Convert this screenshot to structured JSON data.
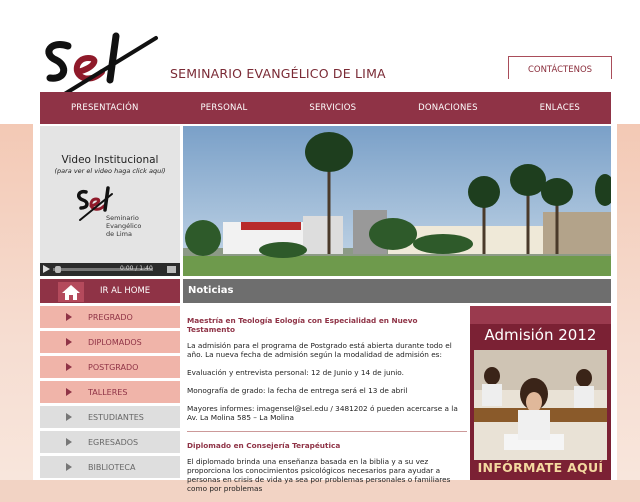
{
  "site": {
    "title": "SEMINARIO EVANGÉLICO DE LIMA",
    "logo_text": "sel"
  },
  "contact_label": "CONTÁCTENOS",
  "nav": [
    "PRESENTACIÓN",
    "PERSONAL",
    "SERVICIOS",
    "DONACIONES",
    "ENLACES"
  ],
  "video": {
    "title": "Video Institucional",
    "subtitle": "(para ver el video haga click aquí)",
    "logo_lines": [
      "Seminario",
      "Evangélico",
      "de Lima"
    ],
    "time": "0:00 / 1:40"
  },
  "home_label": "IR AL HOME",
  "menu": [
    {
      "label": "PREGRADO",
      "style": "pink"
    },
    {
      "label": "DIPLOMADOS",
      "style": "pink"
    },
    {
      "label": "POSTGRADO",
      "style": "pink"
    },
    {
      "label": "TALLERES",
      "style": "pink"
    },
    {
      "label": "ESTUDIANTES",
      "style": "grey"
    },
    {
      "label": "EGRESADOS",
      "style": "grey"
    },
    {
      "label": "BIBLIOTECA",
      "style": "grey"
    }
  ],
  "news": {
    "header": "Noticias",
    "item1": {
      "title": "Maestría en Teología Eología con Especialidad en Nuevo Testamento",
      "p1": "La admisión para el programa de Postgrado está abierta durante todo el año. La nueva fecha de admisión según la modalidad de admisión es:",
      "p2": "Evaluación y entrevista personal: 12 de Junio y 14 de junio.",
      "p3": "Monografía de grado: la fecha de entrega será el 13 de abril",
      "p4": "Mayores informes: imagensel@sel.edu / 3481202 ó pueden acercarse a la Av. La Molina 585 – La Molina"
    },
    "item2": {
      "title": "Diplomado en Consejería Terapéutica",
      "p1": "El diplomado brinda una enseñanza basada en la biblia y a su vez proporciona los conocimientos psicológicos necesarios para ayudar a personas en crisis de vida ya sea por problemas personales o familiares como por problemas"
    }
  },
  "promo": {
    "title": "Admisión 2012",
    "cta": "INFÓRMATE AQUÍ"
  },
  "colors": {
    "brand": "#8f3346",
    "menu_pink": "#f0b4a9",
    "menu_grey": "#dedede"
  },
  "icons": {
    "home": "home-icon",
    "play": "play-icon",
    "volume": "volume-icon"
  }
}
